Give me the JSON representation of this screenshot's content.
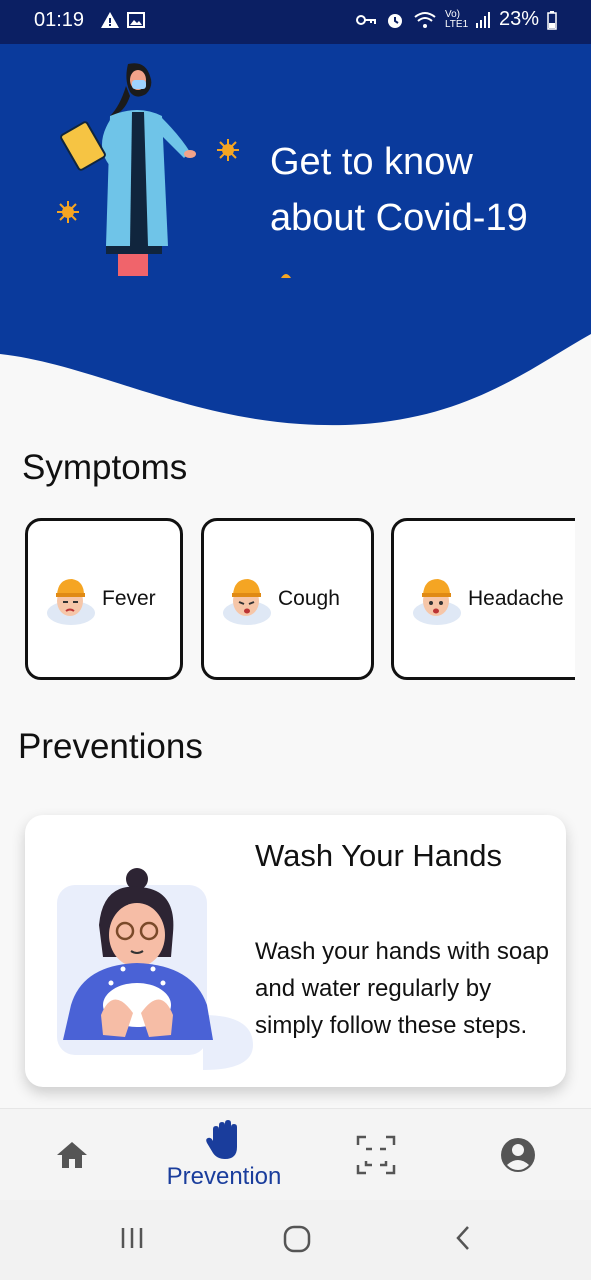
{
  "status_bar": {
    "time": "01:19",
    "battery": "23%",
    "network": "Vo) LTE1"
  },
  "hero": {
    "title_line1": "Get to know",
    "title_line2": "about Covid-19",
    "background_color": "#0a3a9c"
  },
  "symptoms": {
    "title": "Symptoms",
    "items": [
      {
        "label": "Fever",
        "icon": "sick-face-icon"
      },
      {
        "label": "Cough",
        "icon": "coughing-face-icon"
      },
      {
        "label": "Headache",
        "icon": "headache-face-icon"
      }
    ]
  },
  "preventions": {
    "title": "Preventions",
    "card": {
      "title": "Wash Your Hands",
      "description": "Wash your hands with soap and water regularly by simply follow these steps."
    }
  },
  "bottom_nav": {
    "items": [
      {
        "icon": "home-icon",
        "label": ""
      },
      {
        "icon": "hand-icon",
        "label": "Prevention"
      },
      {
        "icon": "scan-icon",
        "label": ""
      },
      {
        "icon": "account-icon",
        "label": ""
      }
    ],
    "active_color": "#1a3d9c"
  }
}
